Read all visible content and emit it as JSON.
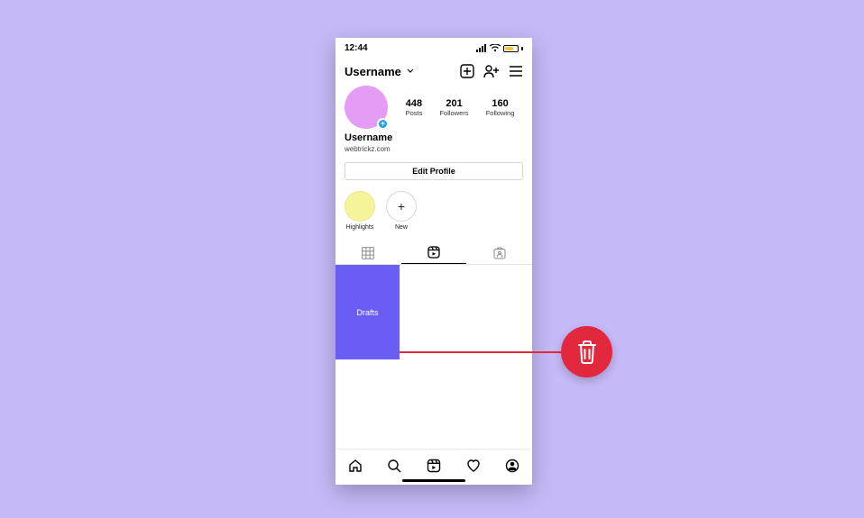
{
  "statusbar": {
    "time": "12:44"
  },
  "header": {
    "username": "Username",
    "icons": {
      "create": "create-icon",
      "find_people": "add-person-icon",
      "menu": "menu-icon"
    }
  },
  "stats": {
    "posts": {
      "value": "448",
      "label": "Posts"
    },
    "followers": {
      "value": "201",
      "label": "Followers"
    },
    "following": {
      "value": "160",
      "label": "Following"
    }
  },
  "bio": {
    "display_name": "Username",
    "link": "webtrickz.com"
  },
  "buttons": {
    "edit_profile": "Edit Profile"
  },
  "highlights": [
    {
      "label": "Highlights"
    },
    {
      "label": "New"
    }
  ],
  "tabs": {
    "grid": "grid-icon",
    "reels": "reels-icon",
    "tagged": "tagged-icon",
    "active": "reels"
  },
  "reels": {
    "drafts_label": "Drafts"
  },
  "annotation": {
    "icon_name": "trash-icon"
  },
  "bottom_nav": {
    "home": "home-icon",
    "search": "search-icon",
    "reels": "reels-icon",
    "activity": "heart-icon",
    "profile": "profile-icon"
  }
}
